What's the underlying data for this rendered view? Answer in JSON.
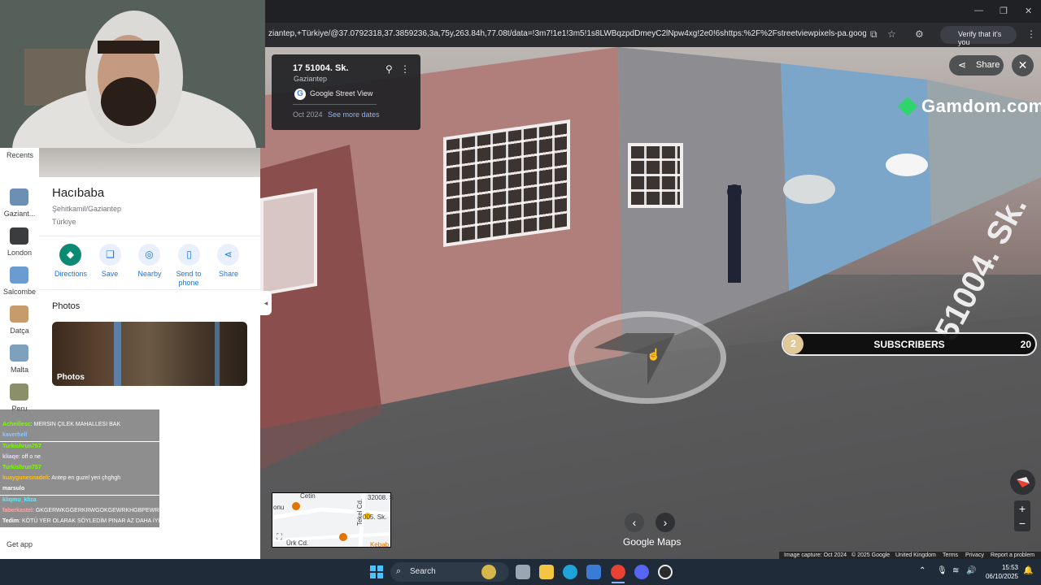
{
  "browser": {
    "url": "ziantep,+Türkiye/@37.0792318,37.3859236,3a,75y,263.84h,77.08t/data=!3m7!1e1!3m5!1s8LWBqzpdDmeyC2lNpw4xg!2e0!6shttps:%2F%2Fstreetviewpixels-pa.googleapis.com%2...",
    "verify_label": "Verify that it's you"
  },
  "streetview": {
    "card_title": "17 51004. Sk.",
    "card_subtitle": "Gaziantep",
    "card_gsv": "Google Street View",
    "card_date": "Oct 2024",
    "card_more": "See more dates",
    "share_label": "Share",
    "gamdom": "Gamdom.com",
    "street_sign": "51004. Sk.",
    "footer": [
      "Image capture: Oct 2024",
      "© 2025 Google",
      "United Kingdom",
      "Terms",
      "Privacy",
      "Report a problem"
    ],
    "google_maps": "Google Maps"
  },
  "subscribers": {
    "count": "2",
    "label": "SUBSCRIBERS",
    "goal": "20"
  },
  "minimap": {
    "labels": [
      "32008. S",
      "005. Sk.",
      "Tekel Cd.",
      "Ürk Cd.",
      "Kebab",
      "onu",
      "Cetin"
    ]
  },
  "rail": {
    "recents": "Recents",
    "items": [
      "Gaziant...",
      "London",
      "Salcombe",
      "Datça",
      "Malta",
      "Peru"
    ],
    "get_app": "Get app"
  },
  "place": {
    "name": "Hacıbaba",
    "addr1": "Şehitkamil/Gaziantep",
    "addr2": "Türkiye",
    "actions": [
      "Directions",
      "Save",
      "Nearby",
      "Send to phone",
      "Share"
    ],
    "photos_heading": "Photos",
    "photos_caption": "Photos"
  },
  "chat": [
    {
      "user": "",
      "text": "",
      "color": "#7dd3fc"
    },
    {
      "user": "Acheillesc",
      "text": ": MERSIN ÇILEK MAHALLESI BAK",
      "color": "#7CFC00"
    },
    {
      "user": "kaverhell",
      "text": "",
      "color": "#93c5fd"
    },
    {
      "user": "Turkishrun757",
      "text": "",
      "color": "#7CFC00"
    },
    {
      "user": "kliaqe",
      "text": ": off o ne",
      "color": "#e9d5ff"
    },
    {
      "user": "Turkishrun757",
      "text": "",
      "color": "#7CFC00"
    },
    {
      "user": "kuaygunesnadeli",
      "text": ": Antep en guzel yeri çhghgh",
      "color": "#fbbf24"
    },
    {
      "user": "marsulo",
      "text": "",
      "color": "#fff"
    },
    {
      "user": "kliqmu_kliza",
      "text": "",
      "color": "#67e8f9"
    },
    {
      "user": "faberkastel",
      "text": ": GKGERWKGGERKRWGOKGEWRKHGBPEWRHGEWRH",
      "color": "#fca5a5"
    },
    {
      "user": "Tedim",
      "text": ": KÖTÜ YER OLARAK SÖYLEDİM PINAR AZ DAHA İYİ",
      "color": "#fff"
    }
  ],
  "taskbar": {
    "search": "Search",
    "time": "15:53",
    "date": "06/10/2025"
  },
  "colors": {
    "accent": "#1a73e8",
    "taskbar": "#1f2b38",
    "sub_badge": "#e1c99a"
  }
}
